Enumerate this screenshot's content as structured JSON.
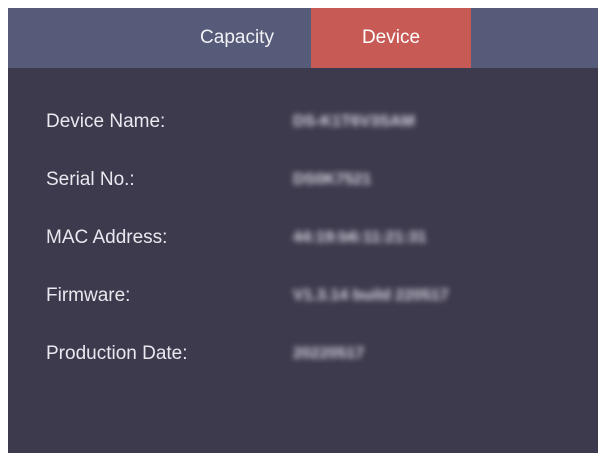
{
  "tabs": {
    "capacity": "Capacity",
    "device": "Device",
    "active": "device"
  },
  "colors": {
    "panel_background": "#3e3a4d",
    "tab_bar_background": "#555b78",
    "active_tab": "#c85a55",
    "text": "#e9e8ef"
  },
  "device_info": {
    "rows": [
      {
        "label": "Device Name:",
        "value": "DS-K1T6V3SAM"
      },
      {
        "label": "Serial No.:",
        "value": "DS0K7521"
      },
      {
        "label": "MAC Address:",
        "value": "44:19:b6:11:21:31"
      },
      {
        "label": "Firmware:",
        "value": "V1.3.14 build 220517"
      },
      {
        "label": "Production Date:",
        "value": "20220517"
      }
    ]
  }
}
